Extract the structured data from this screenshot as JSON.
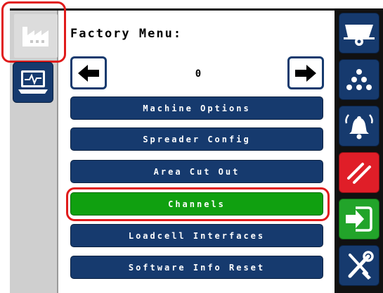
{
  "screen": {
    "title": "Factory Menu:",
    "page_number": "0"
  },
  "menu": {
    "items": [
      {
        "label": "Machine Options",
        "active": false
      },
      {
        "label": "Spreader Config",
        "active": false
      },
      {
        "label": "Area Cut Out",
        "active": false
      },
      {
        "label": "Channels",
        "active": true
      },
      {
        "label": "Loadcell Interfaces",
        "active": false
      },
      {
        "label": "Software Info Reset",
        "active": false
      }
    ]
  },
  "left_sidebar": {
    "items": [
      {
        "icon": "factory-icon",
        "selected": true
      },
      {
        "icon": "laptop-monitor-icon",
        "selected": false
      }
    ]
  },
  "right_sidebar": {
    "items": [
      {
        "icon": "spreader-machine-icon",
        "color": "#163a6e"
      },
      {
        "icon": "dots-pyramid-icon",
        "color": "#163a6e"
      },
      {
        "icon": "alarm-bell-icon",
        "color": "#163a6e"
      },
      {
        "icon": "slash-lines-icon",
        "color": "#e01e28"
      },
      {
        "icon": "enter-arrow-icon",
        "color": "#22a42a"
      },
      {
        "icon": "tools-wrench-screwdriver-icon",
        "color": "#163a6e"
      }
    ]
  },
  "colors": {
    "menu_button": "#163a6e",
    "menu_button_active": "#10a010",
    "highlight": "#e01b1b"
  }
}
